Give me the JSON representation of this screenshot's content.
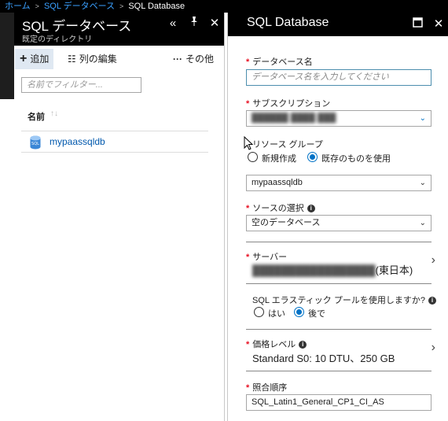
{
  "breadcrumb": {
    "items": [
      "ホーム",
      "SQL データベース",
      "SQL Database"
    ]
  },
  "left_blade": {
    "title": "SQL データベース",
    "subtitle": "既定のディレクトリ",
    "commands": {
      "add": "追加",
      "edit_columns": "列の編集",
      "more": "その他"
    },
    "filter_placeholder": "名前でフィルター...",
    "column_header": "名前",
    "rows": [
      {
        "name": "mypaassqldb"
      }
    ]
  },
  "right_blade": {
    "title": "SQL Database",
    "fields": {
      "db_name": {
        "label": "データベース名",
        "placeholder": "データベース名を入力してください",
        "required": true
      },
      "subscription": {
        "label": "サブスクリプション",
        "required": true
      },
      "resource_group": {
        "label": "リソース グループ",
        "options": [
          "新規作成",
          "既存のものを使用"
        ],
        "selected": "既存のものを使用",
        "value": "mypaassqldb"
      },
      "source": {
        "label": "ソースの選択",
        "value": "空のデータベース",
        "required": true
      },
      "server": {
        "label": "サーバー",
        "suffix": "(東日本)",
        "required": true
      },
      "elastic_pool": {
        "label": "SQL エラスティック プールを使用しますか?",
        "options": [
          "はい",
          "後で"
        ],
        "selected": "後で"
      },
      "pricing": {
        "label": "価格レベル",
        "value": "Standard S0: 10 DTU、250 GB",
        "required": true
      },
      "collation": {
        "label": "照合順序",
        "value": "SQL_Latin1_General_CP1_CI_AS",
        "required": true
      }
    }
  },
  "colors": {
    "accent": "#0072c6",
    "link": "#0058ad",
    "required": "#e81123",
    "header_bg": "#000000"
  }
}
